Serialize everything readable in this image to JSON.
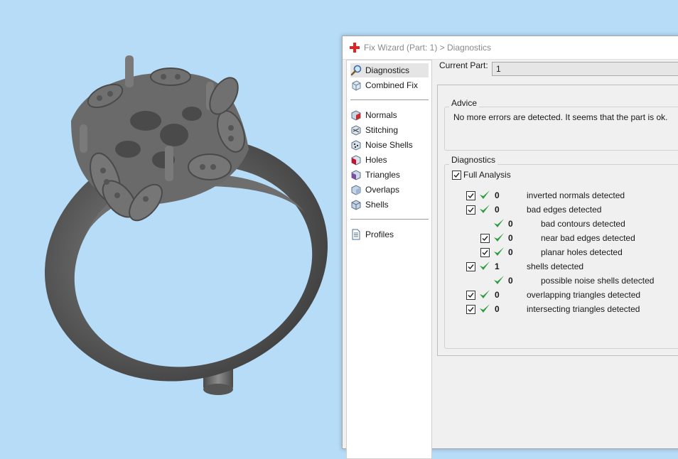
{
  "window": {
    "title": "Fix Wizard (Part: 1) > Diagnostics",
    "icon": "red-cross-icon"
  },
  "nav": {
    "items": [
      {
        "key": "diagnostics",
        "label": "Diagnostics",
        "icon": "magnifier-icon",
        "selected": true
      },
      {
        "key": "combined-fix",
        "label": "Combined Fix",
        "icon": "cube-icon"
      },
      {
        "key": "normals",
        "label": "Normals",
        "icon": "normals-cube-icon"
      },
      {
        "key": "stitching",
        "label": "Stitching",
        "icon": "stitching-icon"
      },
      {
        "key": "noise-shells",
        "label": "Noise Shells",
        "icon": "noise-shells-icon"
      },
      {
        "key": "holes",
        "label": "Holes",
        "icon": "holes-icon"
      },
      {
        "key": "triangles",
        "label": "Triangles",
        "icon": "triangles-icon"
      },
      {
        "key": "overlaps",
        "label": "Overlaps",
        "icon": "overlaps-icon"
      },
      {
        "key": "shells",
        "label": "Shells",
        "icon": "shells-icon"
      },
      {
        "key": "profiles",
        "label": "Profiles",
        "icon": "document-icon"
      }
    ]
  },
  "current_part": {
    "label": "Current Part:",
    "value": "1"
  },
  "advice": {
    "title": "Advice",
    "text": "No more errors are detected. It seems that the part is ok."
  },
  "diagnostics": {
    "title": "Diagnostics",
    "full_analysis": {
      "label": "Full Analysis",
      "checked": true
    },
    "rows": [
      {
        "checked": true,
        "indent": 0,
        "count": "0",
        "label": "inverted normals detected"
      },
      {
        "checked": true,
        "indent": 0,
        "count": "0",
        "label": "bad edges detected"
      },
      {
        "checked": null,
        "indent": 1,
        "count": "0",
        "label": "bad contours detected"
      },
      {
        "checked": true,
        "indent": 1,
        "count": "0",
        "label": "near bad edges detected"
      },
      {
        "checked": true,
        "indent": 1,
        "count": "0",
        "label": "planar holes detected"
      },
      {
        "checked": true,
        "indent": 0,
        "count": "1",
        "label": "shells detected"
      },
      {
        "checked": null,
        "indent": 1,
        "count": "0",
        "label": "possible noise shells detected"
      },
      {
        "checked": true,
        "indent": 0,
        "count": "0",
        "label": "overlapping triangles detected"
      },
      {
        "checked": true,
        "indent": 0,
        "count": "0",
        "label": "intersecting triangles detected"
      }
    ]
  },
  "colors": {
    "viewport_bg": "#b7dcf7",
    "model": "#5f5f5f",
    "ok_check": "#2e9b3f"
  }
}
